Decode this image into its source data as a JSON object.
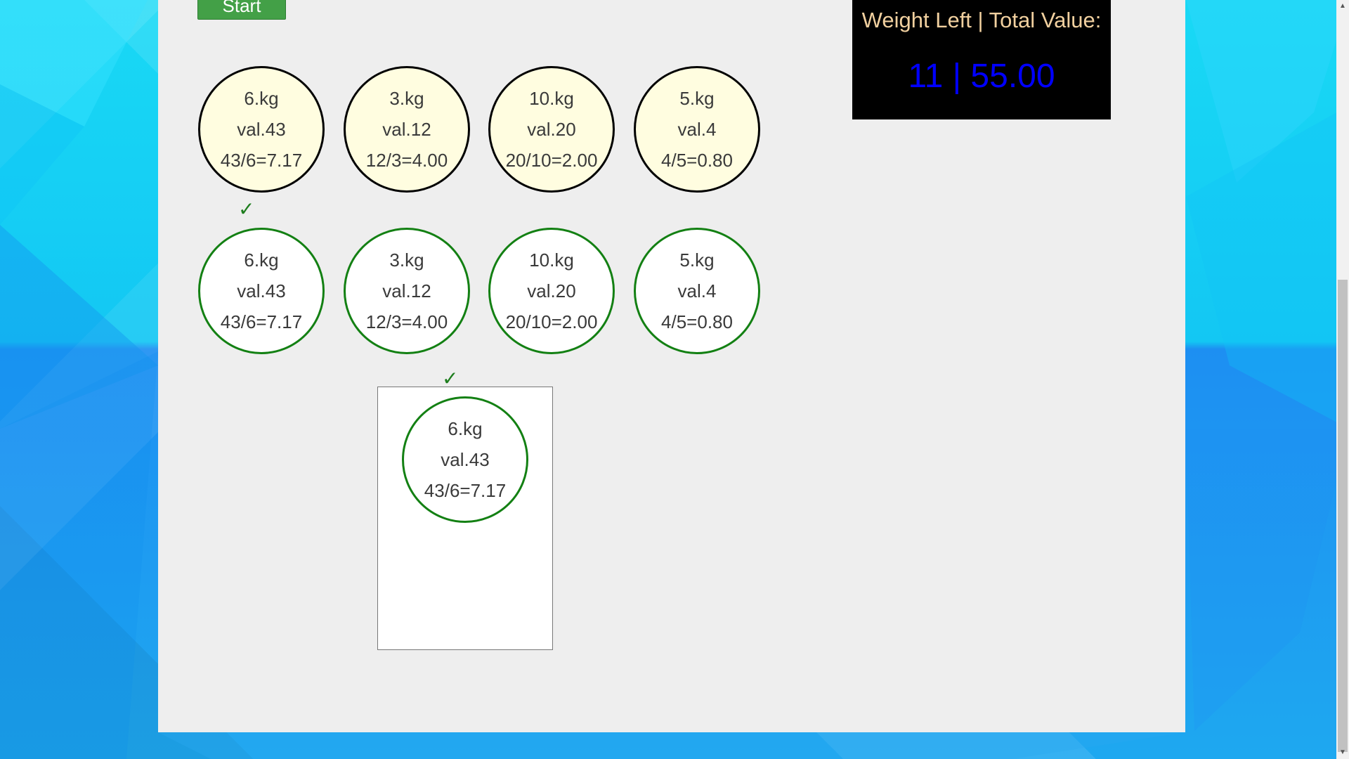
{
  "app": {
    "start_button": "Start"
  },
  "scoreboard": {
    "title": "Weight Left | Total Value:",
    "value": "11 | 55.00"
  },
  "items_row1": [
    {
      "weight": "6.kg",
      "value": "val.43",
      "ratio": "43/6=7.17"
    },
    {
      "weight": "3.kg",
      "value": "val.12",
      "ratio": "12/3=4.00"
    },
    {
      "weight": "10.kg",
      "value": "val.20",
      "ratio": "20/10=2.00"
    },
    {
      "weight": "5.kg",
      "value": "val.4",
      "ratio": "4/5=0.80"
    }
  ],
  "items_row2": [
    {
      "weight": "6.kg",
      "value": "val.43",
      "ratio": "43/6=7.17"
    },
    {
      "weight": "3.kg",
      "value": "val.12",
      "ratio": "12/3=4.00"
    },
    {
      "weight": "10.kg",
      "value": "val.20",
      "ratio": "20/10=2.00"
    },
    {
      "weight": "5.kg",
      "value": "val.4",
      "ratio": "4/5=0.80"
    }
  ],
  "bag_item": {
    "weight": "6.kg",
    "value": "val.43",
    "ratio": "43/6=7.17"
  },
  "marks": {
    "check": "✓"
  }
}
